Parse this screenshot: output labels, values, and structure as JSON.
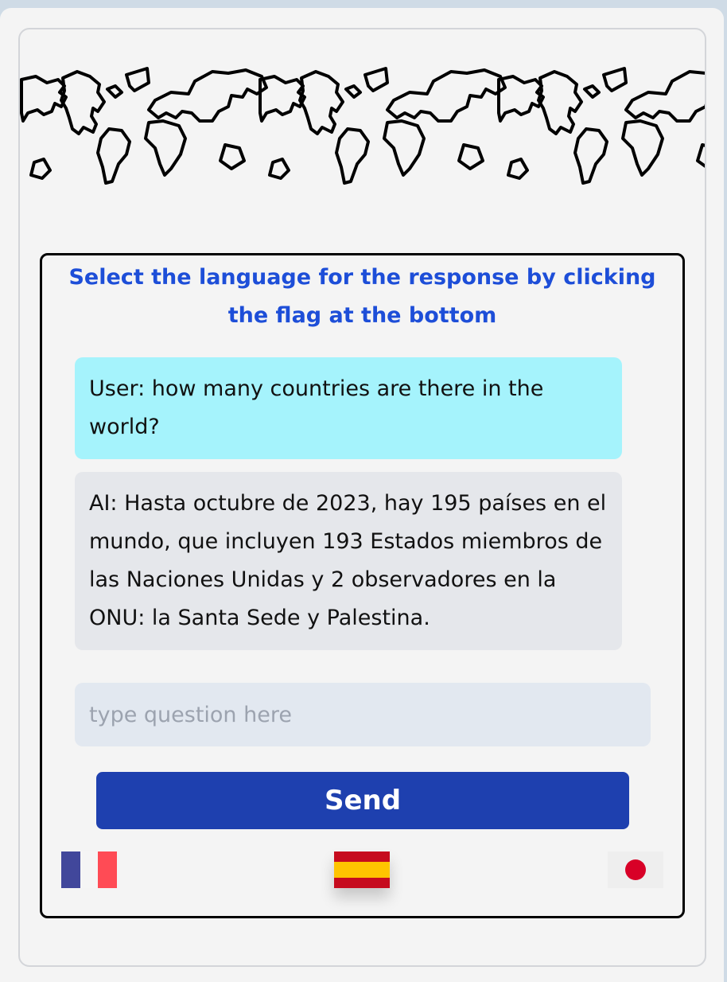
{
  "instruction": "Select the language for the response by clicking the flag at the bottom",
  "messages": {
    "user": "User: how many countries are there in the world?",
    "ai": "AI: Hasta octubre de 2023, hay 195 países en el mundo, que incluyen 193 Estados miembros de las Naciones Unidas y 2 observadores en la ONU: la Santa Sede y Palestina."
  },
  "input": {
    "placeholder": "type question here",
    "value": ""
  },
  "send_label": "Send",
  "flags": [
    {
      "name": "france-flag-icon",
      "colors": [
        "#41479b",
        "#f5f5f5",
        "#ff4b55"
      ]
    },
    {
      "name": "spain-flag-icon",
      "colors": [
        "#c60b1e",
        "#ffc400"
      ],
      "selected": true
    },
    {
      "name": "japan-flag-icon",
      "colors": [
        "#f5f5f5",
        "#d80027"
      ]
    }
  ],
  "colors": {
    "accent": "#1e40af",
    "instruction": "#1d4ed8",
    "user_bubble": "#a5f3fc",
    "ai_bubble": "#e5e7eb"
  }
}
